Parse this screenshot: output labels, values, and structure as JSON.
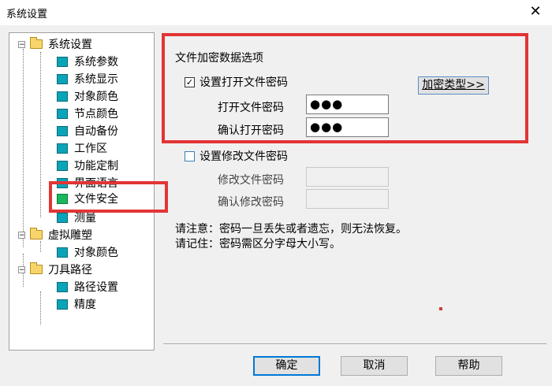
{
  "window": {
    "title": "系统设置",
    "close_glyph": "✕"
  },
  "tree": [
    {
      "label": "系统设置",
      "type": "folder",
      "expander": "−"
    },
    {
      "label": "系统参数",
      "type": "page"
    },
    {
      "label": "系统显示",
      "type": "page"
    },
    {
      "label": "对象颜色",
      "type": "page"
    },
    {
      "label": "节点颜色",
      "type": "page"
    },
    {
      "label": "自动备份",
      "type": "page"
    },
    {
      "label": "工作区",
      "type": "page"
    },
    {
      "label": "功能定制",
      "type": "page"
    },
    {
      "label": "界面语言",
      "type": "page"
    },
    {
      "label": "文件安全",
      "type": "page",
      "selected": true
    },
    {
      "label": "测量",
      "type": "page"
    },
    {
      "label": "虚拟雕塑",
      "type": "folder",
      "expander": "−"
    },
    {
      "label": "对象颜色",
      "type": "page"
    },
    {
      "label": "刀具路径",
      "type": "folder",
      "expander": "−"
    },
    {
      "label": "路径设置",
      "type": "page"
    },
    {
      "label": "精度",
      "type": "page"
    }
  ],
  "main": {
    "section_title": "文件加密数据选项",
    "open_password": {
      "checkbox_label": "设置打开文件密码",
      "checked": true,
      "check_glyph": "✓",
      "password_label": "打开文件密码",
      "password_value": "●●●",
      "confirm_label": "确认打开密码",
      "confirm_value": "●●●"
    },
    "encrypt_type_button": "加密类型>>",
    "modify_password": {
      "checkbox_label": "设置修改文件密码",
      "checked": false,
      "password_label": "修改文件密码",
      "confirm_label": "确认修改密码"
    },
    "note1": "请注意：密码一旦丢失或者遗忘，则无法恢复。",
    "note2": "请记住：密码需区分字母大小写。"
  },
  "buttons": {
    "ok": "确定",
    "cancel": "取消",
    "help": "帮助"
  },
  "colors": {
    "highlight_box": "#e23535",
    "page_icon": "#0aa4b8",
    "folder_icon": "#f7d56b"
  }
}
